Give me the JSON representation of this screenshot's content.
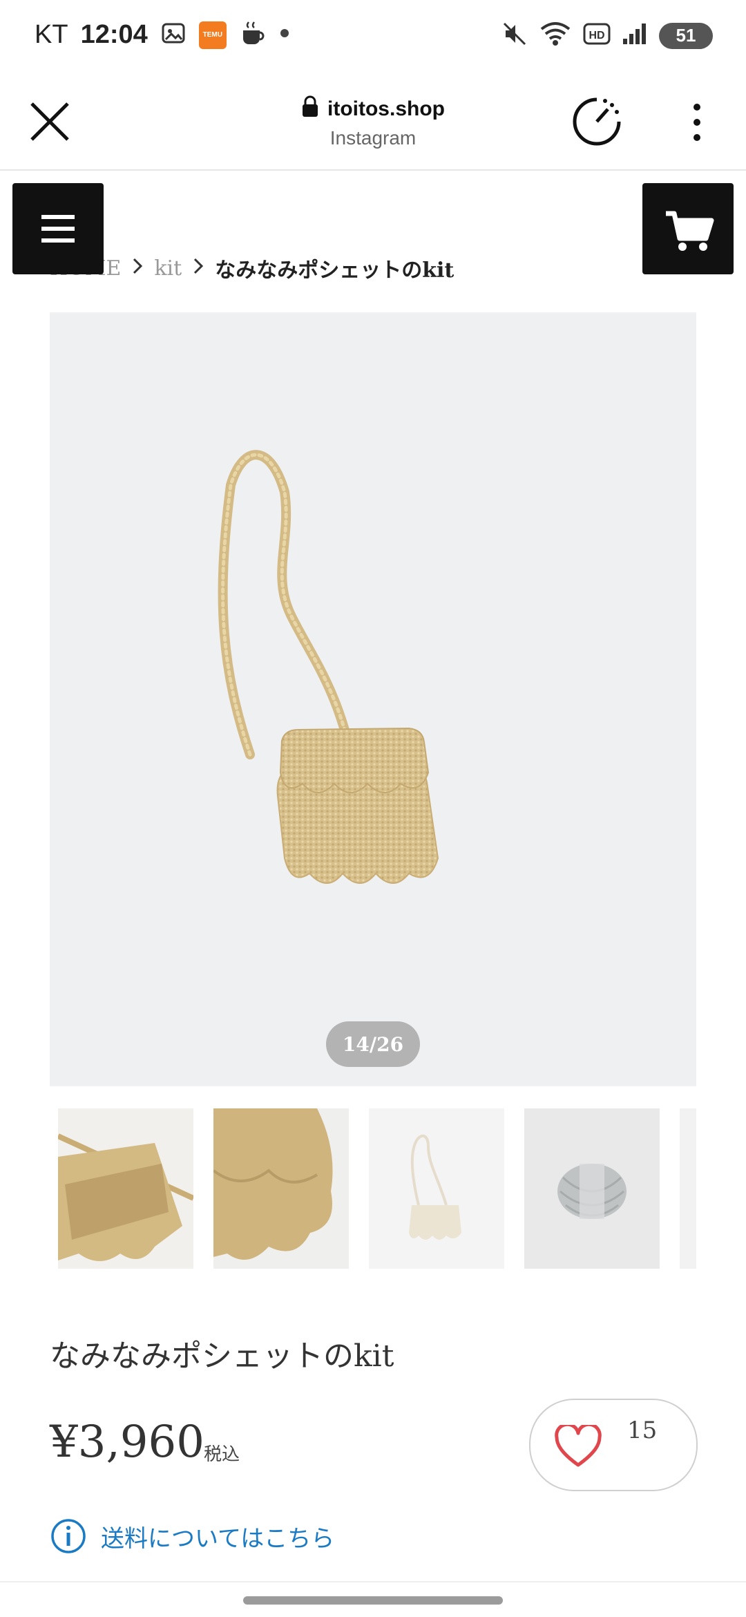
{
  "status_bar": {
    "carrier": "KT",
    "time": "12:04",
    "temu_label": "TEMU",
    "battery": "51"
  },
  "browser": {
    "domain": "itoitos.shop",
    "source": "Instagram"
  },
  "breadcrumb": {
    "home": "HOME",
    "category": "kit",
    "current": "なみなみポシェットのkit"
  },
  "gallery": {
    "counter": "14/26"
  },
  "product": {
    "title": "なみなみポシェットのkit",
    "price": "¥3,960",
    "tax_label": "税込",
    "favorite_count": "15",
    "shipping_link": "送料についてはこちら"
  },
  "colors": {
    "accent_link": "#1a7bc4",
    "heart": "#e0474c",
    "yarn": "#d8c08d"
  }
}
